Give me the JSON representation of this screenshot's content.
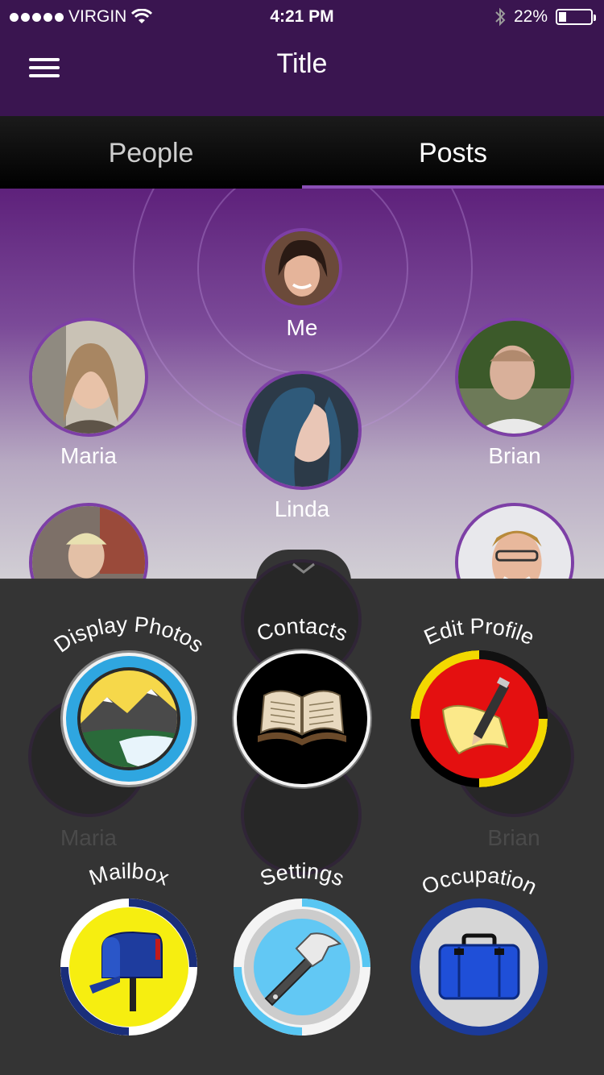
{
  "status_bar": {
    "carrier": "VIRGIN",
    "time": "4:21 PM",
    "battery": "22%"
  },
  "nav": {
    "title": "Title"
  },
  "tabs": [
    {
      "label": "People",
      "active": false
    },
    {
      "label": "Posts",
      "active": true
    }
  ],
  "people": [
    {
      "name": "Me"
    },
    {
      "name": "Maria"
    },
    {
      "name": "Linda"
    },
    {
      "name": "Brian"
    }
  ],
  "ghost_names": [
    "Maria",
    "Brian"
  ],
  "actions": [
    {
      "label": "Display Photos",
      "icon": "landscape-icon"
    },
    {
      "label": "Contacts",
      "icon": "book-icon"
    },
    {
      "label": "Edit Profile",
      "icon": "pen-paper-icon"
    },
    {
      "label": "Mailbox",
      "icon": "mailbox-icon"
    },
    {
      "label": "Settings",
      "icon": "hammer-icon"
    },
    {
      "label": "Occupation",
      "icon": "briefcase-icon"
    }
  ],
  "colors": {
    "nav_bg": "#3a1550",
    "accent": "#8a4fb5",
    "overlay_bg": "#343434"
  }
}
